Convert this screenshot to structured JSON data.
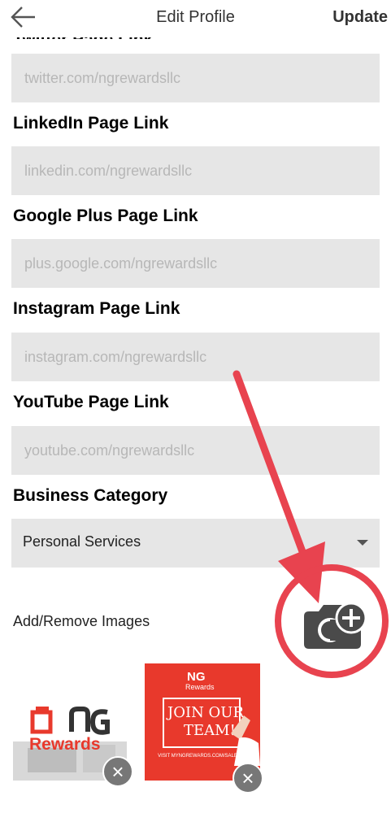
{
  "header": {
    "back_icon": "arrow-left-icon",
    "title": "Edit Profile",
    "update_label": "Update"
  },
  "form": {
    "twitter": {
      "cut_label": "Twitter Page Link",
      "placeholder": "twitter.com/ngrewardsllc"
    },
    "linkedin": {
      "label": "LinkedIn Page Link",
      "placeholder": "linkedin.com/ngrewardsllc"
    },
    "google": {
      "label": "Google Plus Page Link",
      "placeholder": "plus.google.com/ngrewardsllc"
    },
    "instagram": {
      "label": "Instagram Page Link",
      "placeholder": "instagram.com/ngrewardsllc"
    },
    "youtube": {
      "label": "YouTube Page Link",
      "placeholder": "youtube.com/ngrewardsllc"
    },
    "category": {
      "label": "Business Category",
      "value": "Personal Services"
    }
  },
  "images": {
    "label": "Add/Remove Images",
    "add_icon": "camera-plus-icon",
    "items": [
      {
        "logo_top": "NG",
        "logo_bottom": "Rewards"
      },
      {
        "logo_top": "NG",
        "logo_bottom": "Rewards",
        "board_line1": "JOIN OUR",
        "board_line2": "TEAM!",
        "caption": "VISIT MYNGREWARDS.COM/SALESAB"
      }
    ],
    "remove_glyph": "×"
  },
  "colors": {
    "accent_red": "#e8392c",
    "annotation_red": "#e8434f",
    "field_bg": "#e6e6e6"
  }
}
